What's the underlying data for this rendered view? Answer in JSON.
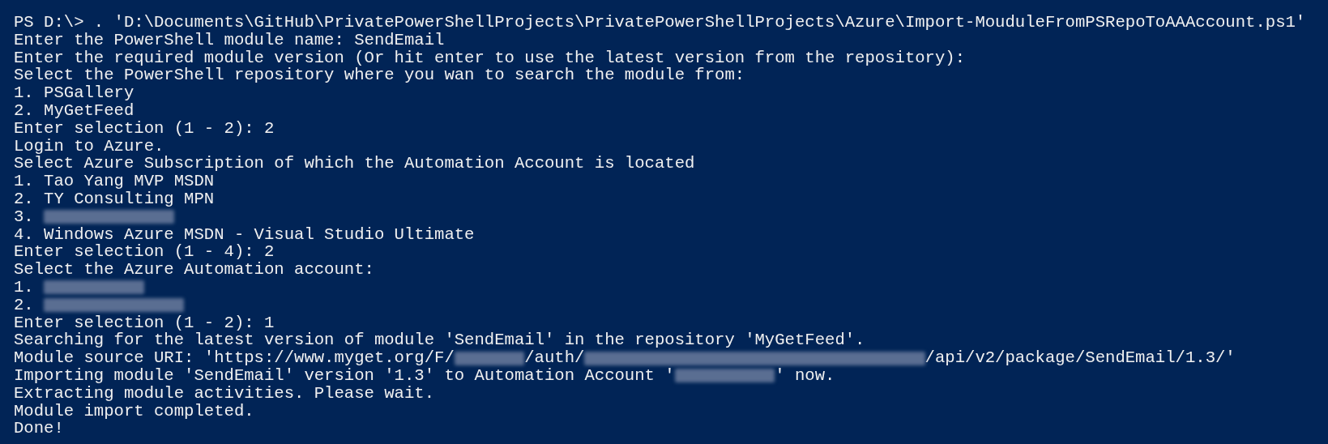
{
  "console": {
    "lines": [
      [
        {
          "kind": "text",
          "text": "PS D:\\> . 'D:\\Documents\\GitHub\\PrivatePowerShellProjects\\PrivatePowerShellProjects\\Azure\\Import-MouduleFromPSRepoToAAAccount.ps1'"
        }
      ],
      [
        {
          "kind": "text",
          "text": "Enter the PowerShell module name: SendEmail"
        }
      ],
      [
        {
          "kind": "text",
          "text": "Enter the required module version (Or hit enter to use the latest version from the repository):"
        }
      ],
      [
        {
          "kind": "text",
          "text": "Select the PowerShell repository where you wan to search the module from:"
        }
      ],
      [
        {
          "kind": "text",
          "text": "1. PSGallery"
        }
      ],
      [
        {
          "kind": "text",
          "text": "2. MyGetFeed"
        }
      ],
      [
        {
          "kind": "text",
          "text": "Enter selection (1 - 2): 2"
        }
      ],
      [
        {
          "kind": "text",
          "text": "Login to Azure."
        }
      ],
      [
        {
          "kind": "text",
          "text": "Select Azure Subscription of which the Automation Account is located"
        }
      ],
      [
        {
          "kind": "text",
          "text": "1. Tao Yang MVP MSDN"
        }
      ],
      [
        {
          "kind": "text",
          "text": "2. TY Consulting MPN"
        }
      ],
      [
        {
          "kind": "text",
          "text": "3. "
        },
        {
          "kind": "blurwide"
        }
      ],
      [
        {
          "kind": "text",
          "text": "4. Windows Azure MSDN - Visual Studio Ultimate"
        }
      ],
      [
        {
          "kind": "text",
          "text": "Enter selection (1 - 4): 2"
        }
      ],
      [
        {
          "kind": "text",
          "text": "Select the Azure Automation account:"
        }
      ],
      [
        {
          "kind": "text",
          "text": "1. "
        },
        {
          "kind": "blurmedium"
        }
      ],
      [
        {
          "kind": "text",
          "text": "2. "
        },
        {
          "kind": "blurwider"
        }
      ],
      [
        {
          "kind": "text",
          "text": "Enter selection (1 - 2): 1"
        }
      ],
      [
        {
          "kind": "text",
          "text": "Searching for the latest version of module 'SendEmail' in the repository 'MyGetFeed'."
        }
      ],
      [
        {
          "kind": "text",
          "text": "Module source URI: 'https://www.myget.org/F/"
        },
        {
          "kind": "blurshort"
        },
        {
          "kind": "text",
          "text": "/auth/"
        },
        {
          "kind": "blurlong"
        },
        {
          "kind": "text",
          "text": "/api/v2/package/SendEmail/1.3/'"
        }
      ],
      [
        {
          "kind": "text",
          "text": "Importing module 'SendEmail' version '1.3' to Automation Account '"
        },
        {
          "kind": "blurmedium"
        },
        {
          "kind": "text",
          "text": "' now."
        }
      ],
      [
        {
          "kind": "text",
          "text": "Extracting module activities. Please wait."
        }
      ],
      [
        {
          "kind": "text",
          "text": "Module import completed."
        }
      ],
      [
        {
          "kind": "text",
          "text": "Done!"
        }
      ]
    ]
  }
}
